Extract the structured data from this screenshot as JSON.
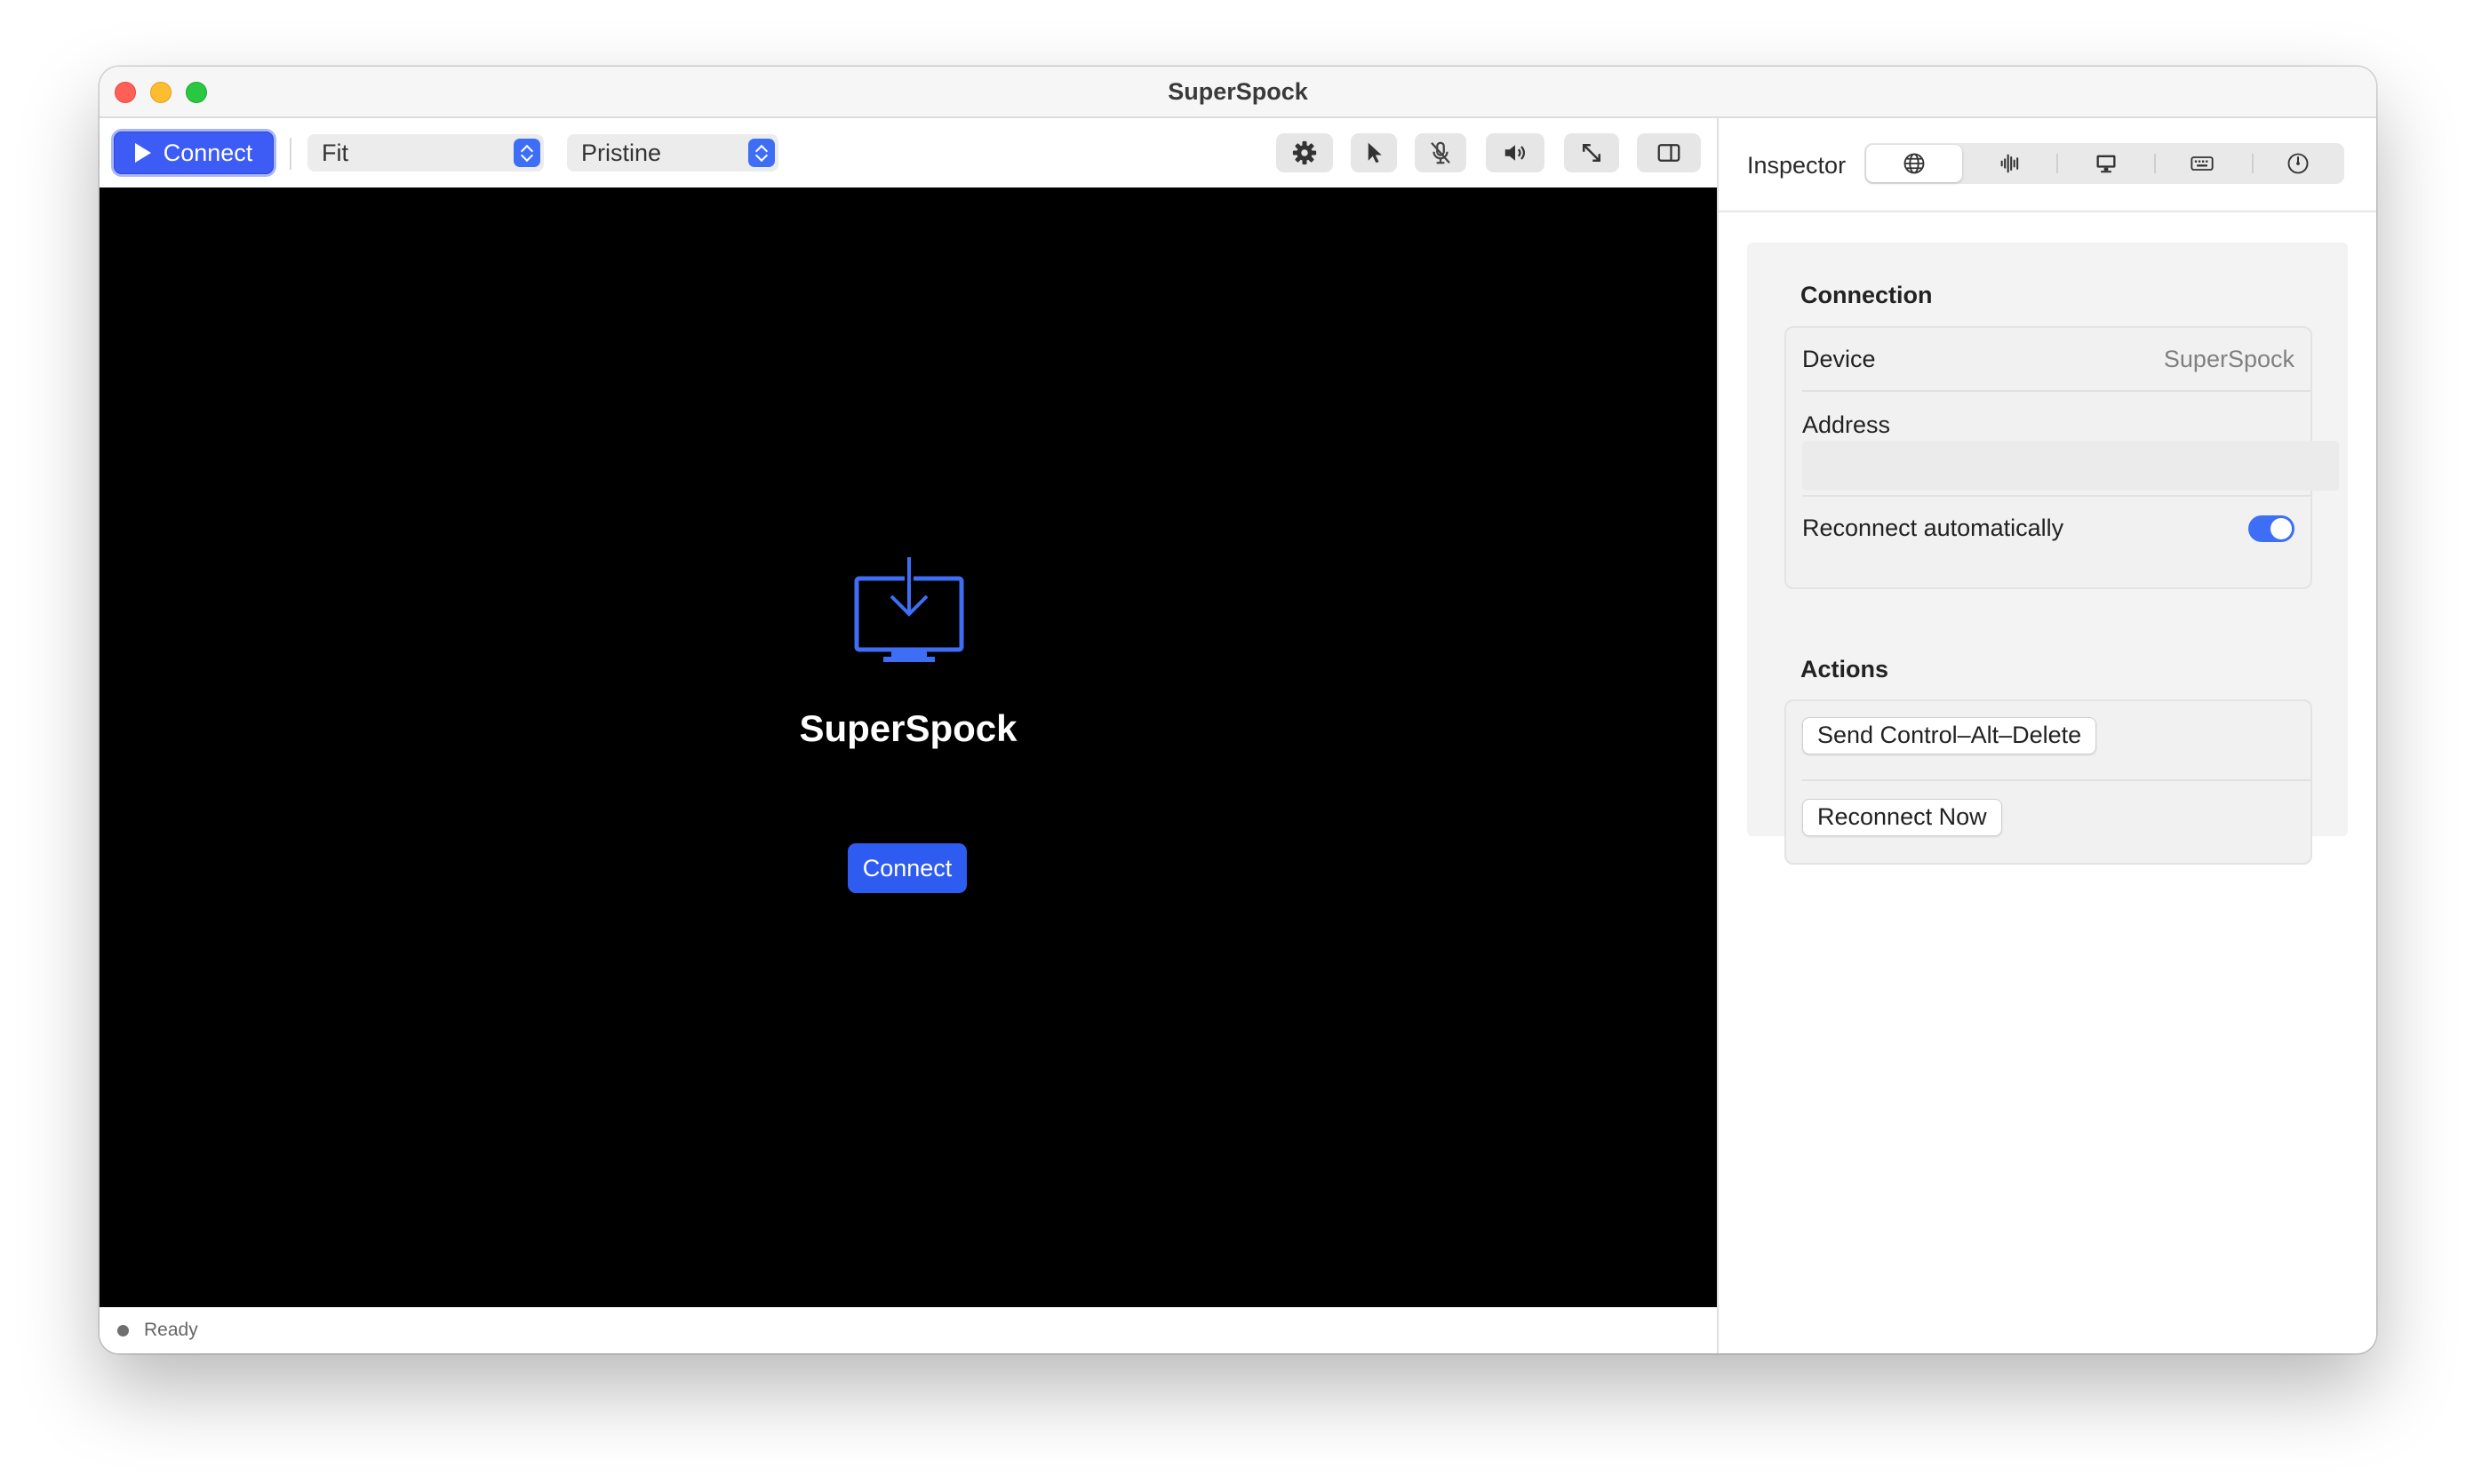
{
  "window": {
    "title": "SuperSpock"
  },
  "toolbar": {
    "connect_label": "Connect",
    "scaling_select": "Fit",
    "quality_select": "Pristine",
    "icons": [
      "gear-icon",
      "pointer-icon",
      "mic-muted-icon",
      "speaker-icon",
      "resize-icon",
      "sidebar-icon"
    ]
  },
  "viewport": {
    "device_name": "SuperSpock",
    "connect_label": "Connect",
    "icon": "monitor-download-icon"
  },
  "status": {
    "text": "Ready"
  },
  "inspector": {
    "label": "Inspector",
    "tabs": [
      "globe-icon",
      "waveform-icon",
      "display-icon",
      "keyboard-icon",
      "gauge-icon"
    ],
    "selected_tab": 0,
    "connection": {
      "title": "Connection",
      "device_label": "Device",
      "device_value": "SuperSpock",
      "address_label": "Address",
      "address_value": "",
      "reconnect_label": "Reconnect automatically",
      "reconnect_enabled": true
    },
    "actions": {
      "title": "Actions",
      "ctrl_alt_del": "Send Control–Alt–Delete",
      "reconnect_now": "Reconnect Now"
    }
  },
  "colors": {
    "accent": "#3d5cf5",
    "toggle": "#3d6ef5",
    "viewport_bg": "#000000"
  }
}
